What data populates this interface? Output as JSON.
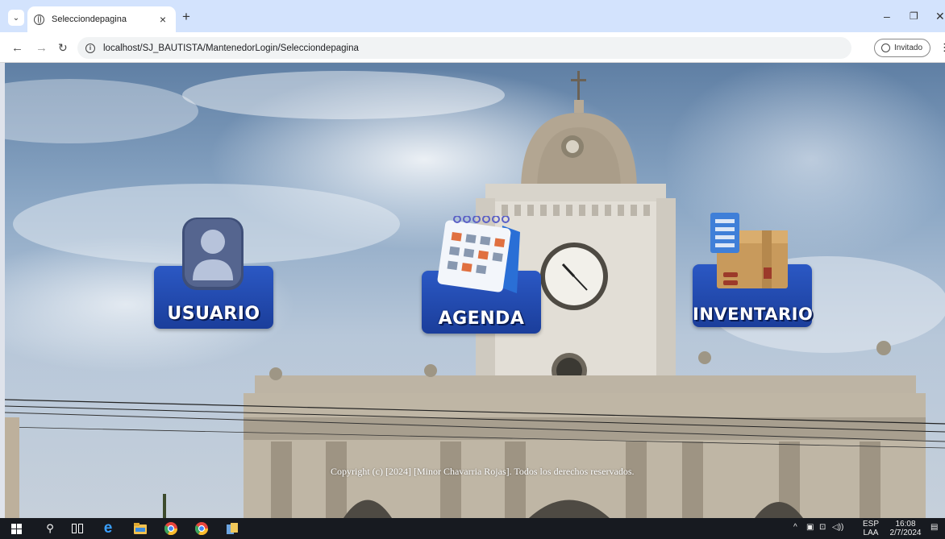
{
  "browser": {
    "tab_title": "Selecciondepagina",
    "tab_close": "×",
    "new_tab": "+",
    "url": "localhost/SJ_BAUTISTA/MantenedorLogin/Selecciondepagina",
    "profile_label": "Invitado",
    "icons": [
      "tab-search-icon",
      "globe-icon",
      "back-icon",
      "forward-icon",
      "reload-icon",
      "info-icon",
      "profile-icon",
      "menu-icon",
      "minimize-icon",
      "restore-icon",
      "close-icon"
    ]
  },
  "tiles": [
    {
      "label": "USUARIO",
      "icon": "user-icon"
    },
    {
      "label": "AGENDA",
      "icon": "calendar-icon"
    },
    {
      "label": "INVENTARIO",
      "icon": "inventory-box-icon"
    }
  ],
  "footer": {
    "copyright": "Copyright (c) [2024] [Minor Chavarria Rojas]. Todos los derechos reservados."
  },
  "taskbar": {
    "icons": [
      "windows-start-icon",
      "search-icon",
      "task-view-icon",
      "edge-icon",
      "file-explorer-icon",
      "chrome-icon",
      "chrome-icon",
      "app-icon"
    ],
    "language_top": "ESP",
    "language_bottom": "LAA",
    "time": "16:08",
    "date": "2/7/2024"
  },
  "colors": {
    "tile_blue": "#2353bd",
    "tab_strip": "#d3e3fd",
    "taskbar": "#171a20"
  }
}
